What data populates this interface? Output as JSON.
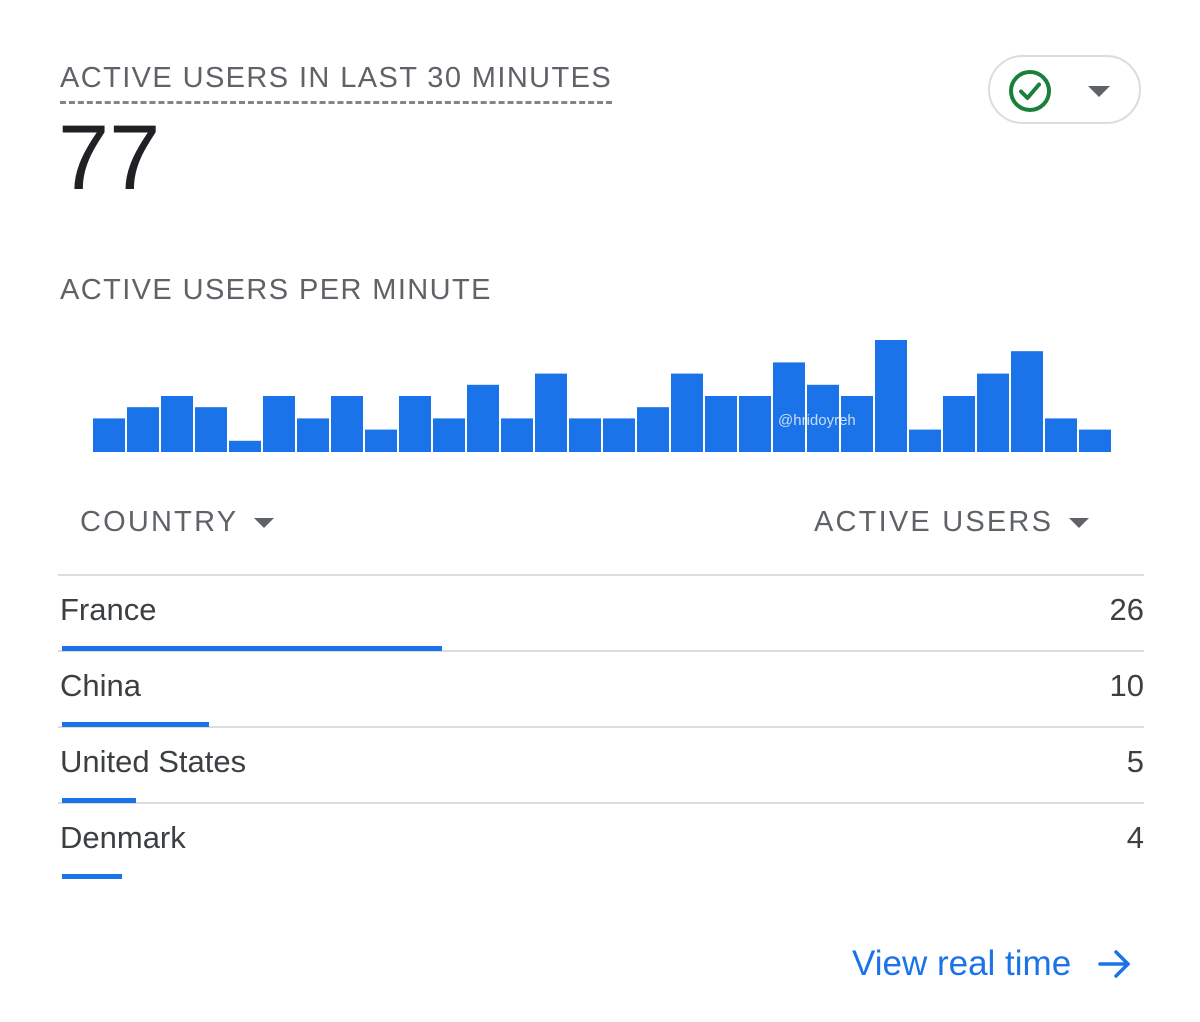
{
  "header": {
    "title": "ACTIVE USERS IN LAST 30 MINUTES",
    "total_active_users": "77"
  },
  "status": {
    "icon": "check-circle-icon",
    "color": "#188038",
    "dropdown_icon": "caret-down-icon"
  },
  "chart": {
    "title": "ACTIVE USERS PER MINUTE",
    "watermark": "@hridoyreh"
  },
  "chart_data": {
    "type": "bar",
    "title": "ACTIVE USERS PER MINUTE",
    "bar_color": "#1a73e8",
    "values": [
      3,
      4,
      5,
      4,
      1,
      5,
      3,
      5,
      2,
      5,
      3,
      6,
      3,
      7,
      3,
      3,
      4,
      7,
      5,
      5,
      8,
      6,
      5,
      10,
      2,
      5,
      7,
      9,
      3,
      2
    ],
    "ylim": [
      0,
      10
    ],
    "grid": false,
    "axes_visible": false
  },
  "table": {
    "columns": [
      {
        "label": "COUNTRY",
        "sort_icon": "caret-down-icon"
      },
      {
        "label": "ACTIVE USERS",
        "sort_icon": "caret-down-icon"
      }
    ],
    "rows": [
      {
        "country": "France",
        "active_users": "26",
        "share": 0.35
      },
      {
        "country": "China",
        "active_users": "10",
        "share": 0.135
      },
      {
        "country": "United States",
        "active_users": "5",
        "share": 0.068
      },
      {
        "country": "Denmark",
        "active_users": "4",
        "share": 0.055
      }
    ],
    "bar_color": "#1a73e8"
  },
  "footer": {
    "link_label": "View real time",
    "link_icon": "arrow-right-icon"
  }
}
